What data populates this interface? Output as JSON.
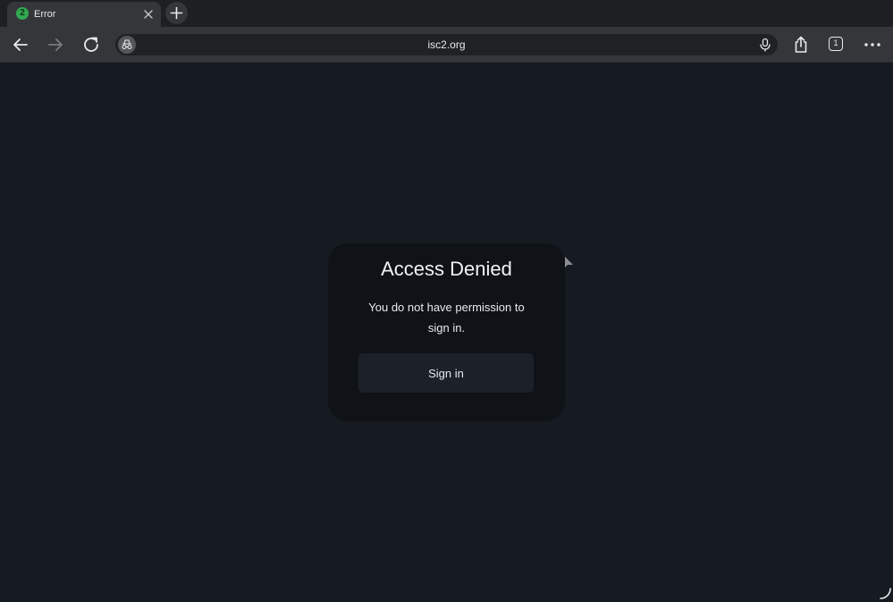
{
  "tabs": [
    {
      "title": "Error",
      "favicon_glyph": "2",
      "favicon_color": "#33a852"
    }
  ],
  "toolbar": {
    "url": "isc2.org",
    "tab_count": "1",
    "icons": {
      "back": "arrow-left-icon",
      "forward": "arrow-right-icon",
      "reload": "reload-icon",
      "site_info": "incognito-icon",
      "mic": "microphone-icon",
      "share": "share-icon",
      "menu": "more-horizontal-icon"
    }
  },
  "dialog": {
    "title": "Access Denied",
    "message": "You do not have permission to sign in.",
    "button_label": "Sign in"
  },
  "colors": {
    "page_background": "#161a21",
    "card_background": "#0f1217",
    "button_background": "#1c2029",
    "toolbar_background": "#35363a"
  }
}
